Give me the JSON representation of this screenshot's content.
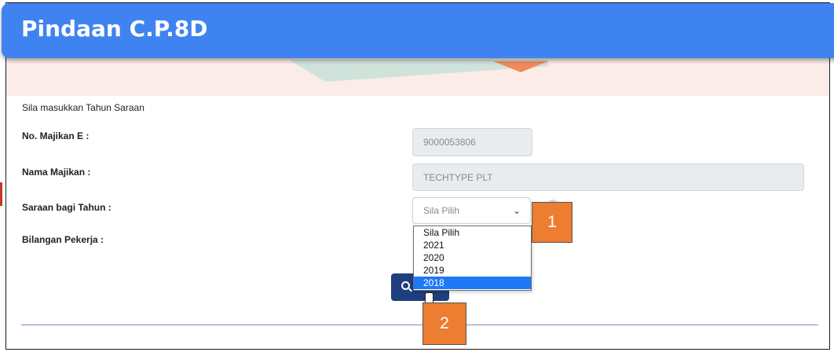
{
  "header": {
    "title": "Pindaan C.P.8D"
  },
  "form": {
    "intro": "Sila masukkan Tahun Saraan",
    "employer_no_label": "No. Majikan E :",
    "employer_no_value": "9000053806",
    "employer_name_label": "Nama Majikan :",
    "employer_name_value": "TECHTYPE PLT",
    "year_label": "Saraan bagi Tahun :",
    "year_selected": "Sila Pilih",
    "year_options": [
      "Sila Pilih",
      "2021",
      "2020",
      "2019",
      "2018"
    ],
    "year_highlighted": "2018",
    "workers_label": "Bilangan Pekerja :"
  },
  "callouts": {
    "first": "1",
    "second": "2"
  },
  "colors": {
    "header": "#3f83f0",
    "search_button": "#1f3e7e",
    "callout": "#ed7d31",
    "highlight": "#1e79f5"
  },
  "icons": {
    "search_button": "search-icon",
    "select": "chevron-down-icon"
  }
}
